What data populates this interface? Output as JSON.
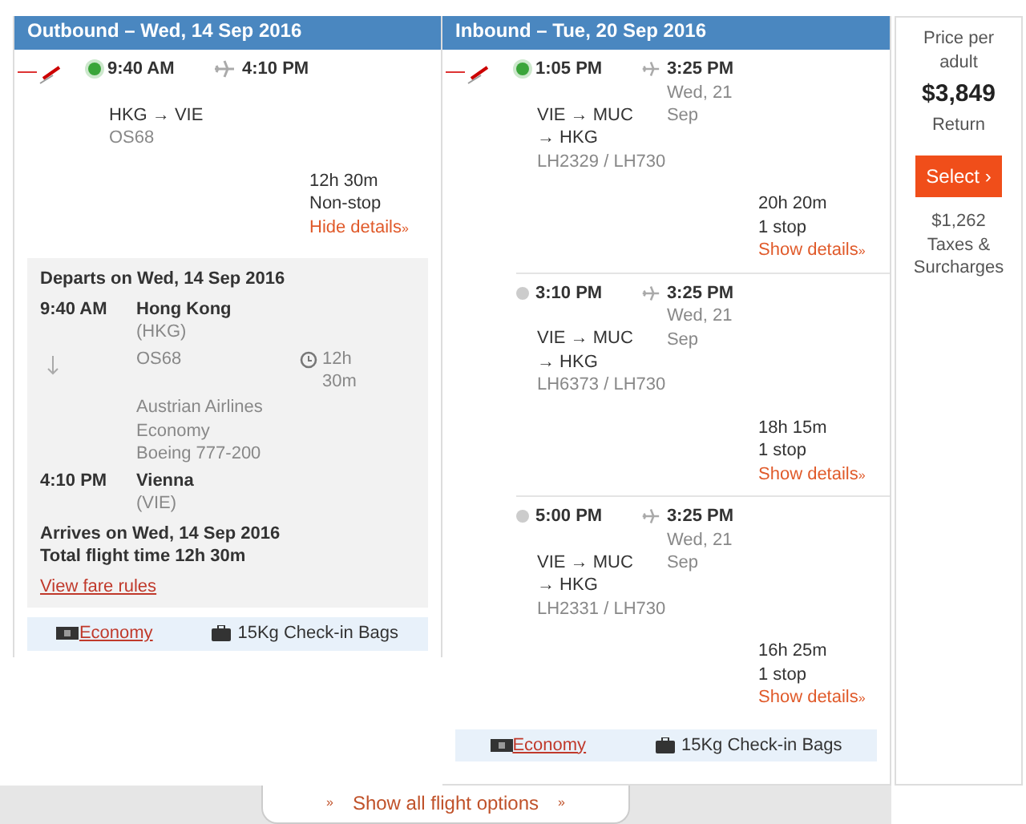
{
  "outbound": {
    "header": "Outbound – Wed, 14 Sep 2016",
    "options": [
      {
        "selected": true,
        "departure": "9:40 AM",
        "arrival": "4:10 PM",
        "route": "HKG → VIE",
        "flight_number": "OS68",
        "duration": "12h 30m",
        "stops": "Non-stop",
        "details_link": "Hide details",
        "details_arrow": "»"
      }
    ],
    "details": {
      "departs_on": "Departs on Wed, 14 Sep 2016",
      "from": {
        "time": "9:40 AM",
        "city": "Hong Kong",
        "code": "(HKG)"
      },
      "flight_number": "OS68",
      "flight_time": "12h 30m",
      "info": [
        "Austrian Airlines",
        "Economy",
        "Boeing 777-200"
      ],
      "to": {
        "time": "4:10 PM",
        "city": "Vienna",
        "code": "(VIE)"
      },
      "arrives_on": "Arrives on Wed, 14 Sep 2016",
      "total": "Total flight time 12h 30m",
      "fare_rules": "View fare rules"
    },
    "fare": {
      "cabin": "Economy",
      "bags": "15Kg Check-in Bags"
    }
  },
  "inbound": {
    "header": "Inbound – Tue, 20 Sep 2016",
    "options": [
      {
        "selected": true,
        "departure": "1:05 PM",
        "arrival": "3:25 PM",
        "arrival_date": "Wed, 21 Sep",
        "route": "VIE → MUC → HKG",
        "flight_number": "LH2329 / LH730",
        "duration": "20h 20m",
        "stops": "1 stop",
        "details_link": "Show details",
        "details_arrow": "»"
      },
      {
        "selected": false,
        "departure": "3:10 PM",
        "arrival": "3:25 PM",
        "arrival_date": "Wed, 21 Sep",
        "route": "VIE → MUC → HKG",
        "flight_number": "LH6373 / LH730",
        "duration": "18h 15m",
        "stops": "1 stop",
        "details_link": "Show details",
        "details_arrow": "»"
      },
      {
        "selected": false,
        "departure": "5:00 PM",
        "arrival": "3:25 PM",
        "arrival_date": "Wed, 21 Sep",
        "route": "VIE → MUC → HKG",
        "flight_number": "LH2331 / LH730",
        "duration": "16h 25m",
        "stops": "1 stop",
        "details_link": "Show details",
        "details_arrow": "»"
      }
    ],
    "fare": {
      "cabin": "Economy",
      "bags": "15Kg Check-in Bags"
    }
  },
  "price": {
    "label": "Price per adult",
    "amount": "$3,849",
    "type": "Return",
    "button": "Select ›",
    "taxes": "$1,262",
    "taxes_label": "Taxes & Surcharges"
  },
  "footer": {
    "arrow_left": "»",
    "link": "Show all flight options",
    "arrow_right": "»"
  }
}
